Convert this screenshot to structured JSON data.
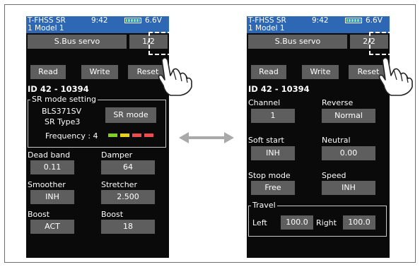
{
  "colors": {
    "status_bar": "#2e68b4",
    "button": "#5e5e5e",
    "screen_bg": "#0a0a0a",
    "freq_bars": [
      "#7ed321",
      "#e8d21a",
      "#ef4d4d",
      "#ef4d4d"
    ]
  },
  "status": {
    "title": "T-FHSS SR",
    "time": "9:42",
    "voltage": "6.6V",
    "model": "1   Model 1"
  },
  "left": {
    "header_button": "S.Bus servo",
    "page": "1/2",
    "read": "Read",
    "write": "Write",
    "reset": "Reset",
    "id": "ID  42  -  10394",
    "sr_group_title": "SR mode setting",
    "servo_name": "BLS371SV",
    "servo_type": "SR Type3",
    "sr_mode_button": "SR mode",
    "frequency": "Frequency : 4",
    "dead_band_label": "Dead band",
    "dead_band_value": "0.11",
    "damper_label": "Damper",
    "damper_value": "64",
    "smoother_label": "Smoother",
    "smoother_value": "INH",
    "stretcher_label": "Stretcher",
    "stretcher_value": "2.500",
    "boost_label": "Boost",
    "boost_value": "ACT",
    "boost2_label": "Boost",
    "boost2_value": "18"
  },
  "right": {
    "header_button": "S.Bus servo",
    "page": "2/2",
    "read": "Read",
    "write": "Write",
    "reset": "Reset",
    "id": "ID  42  -  10394",
    "channel_label": "Channel",
    "channel_value": "1",
    "reverse_label": "Reverse",
    "reverse_value": "Normal",
    "soft_start_label": "Soft start",
    "soft_start_value": "INH",
    "neutral_label": "Neutral",
    "neutral_value": "0.00",
    "stop_mode_label": "Stop mode",
    "stop_mode_value": "Free",
    "speed_label": "Speed",
    "speed_value": "INH",
    "travel_title": "Travel",
    "left_label": "Left",
    "left_value": "100.0",
    "right_label": "Right",
    "right_value": "100.0"
  }
}
